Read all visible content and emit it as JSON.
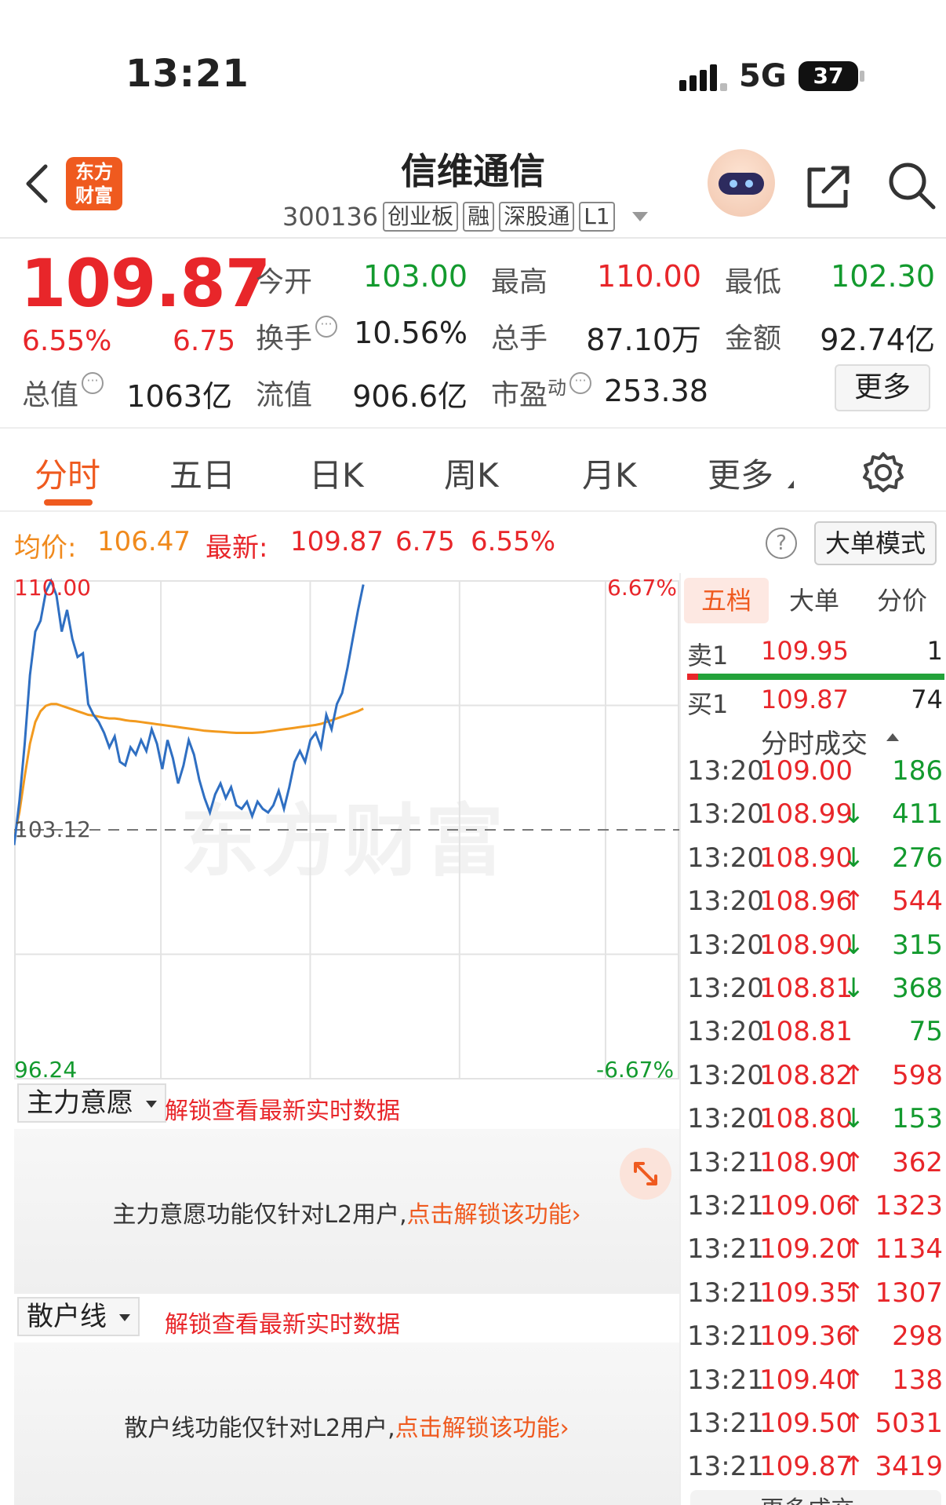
{
  "status_bar": {
    "time": "13:21",
    "network": "5G",
    "battery": "37"
  },
  "header": {
    "logo_text_1": "东方",
    "logo_text_2": "财富",
    "stock_name": "信维通信",
    "stock_code": "300136",
    "tags": [
      "创业板",
      "融",
      "深股通",
      "L1"
    ]
  },
  "quote": {
    "price": "109.87",
    "change_pct": "6.55%",
    "change": "6.75",
    "fields": {
      "open_label": "今开",
      "open": "103.00",
      "high_label": "最高",
      "high": "110.00",
      "low_label": "最低",
      "low": "102.30",
      "turnover_label": "换手",
      "turnover": "10.56%",
      "volume_label": "总手",
      "volume": "87.10万",
      "amount_label": "金额",
      "amount": "92.74亿",
      "mktcap_label": "总值",
      "mktcap": "1063亿",
      "float_label": "流值",
      "float": "906.6亿",
      "pe_label": "市盈",
      "pe_sup": "动",
      "pe": "253.38"
    },
    "more_label": "更多",
    "dots_glyph": "···"
  },
  "tabs": [
    "分时",
    "五日",
    "日K",
    "周K",
    "月K",
    "更多"
  ],
  "info_line": {
    "avg_label": "均价:",
    "avg": "106.47",
    "latest_label": "最新:",
    "latest": "109.87",
    "change": "6.75",
    "pct": "6.55%",
    "help": "?",
    "big_order_mode": "大单模式"
  },
  "chart_data": {
    "type": "line",
    "title": "",
    "y_top_label": "110.00",
    "y_mid_label": "103.12",
    "y_bottom_label": "96.24",
    "pct_top_label": "6.67%",
    "pct_bottom_label": "-6.67%",
    "ylim": [
      96.24,
      110.0
    ],
    "prev_close": 103.12,
    "watermark": "东方财富",
    "series": [
      {
        "name": "price",
        "values": [
          102.7,
          103.9,
          105.5,
          107.4,
          108.6,
          108.9,
          109.7,
          110.0,
          109.6,
          108.6,
          109.2,
          108.4,
          107.9,
          108.0,
          106.6,
          106.3,
          106.1,
          105.8,
          105.4,
          105.7,
          105.0,
          104.9,
          105.4,
          105.2,
          105.6,
          105.3,
          105.9,
          105.5,
          104.8,
          105.6,
          105.1,
          104.4,
          104.9,
          105.6,
          105.2,
          104.5,
          104.0,
          103.6,
          104.1,
          104.4,
          104.0,
          104.3,
          103.8,
          103.7,
          103.9,
          103.5,
          103.9,
          103.7,
          103.6,
          103.8,
          104.2,
          103.7,
          104.3,
          105.0,
          105.3,
          105.0,
          105.6,
          105.8,
          105.4,
          106.3,
          105.9,
          106.6,
          106.9,
          107.6,
          108.4,
          109.2,
          109.9
        ]
      },
      {
        "name": "avg",
        "values": [
          102.9,
          103.6,
          104.6,
          105.5,
          106.1,
          106.4,
          106.55,
          106.6,
          106.6,
          106.55,
          106.5,
          106.45,
          106.4,
          106.35,
          106.3,
          106.28,
          106.25,
          106.22,
          106.2,
          106.2,
          106.18,
          106.15,
          106.13,
          106.12,
          106.1,
          106.08,
          106.06,
          106.04,
          106.02,
          106.0,
          105.98,
          105.96,
          105.94,
          105.92,
          105.9,
          105.88,
          105.86,
          105.85,
          105.84,
          105.83,
          105.82,
          105.81,
          105.8,
          105.8,
          105.8,
          105.8,
          105.81,
          105.82,
          105.84,
          105.86,
          105.88,
          105.9,
          105.92,
          105.94,
          105.96,
          105.98,
          106.0,
          106.02,
          106.05,
          106.1,
          106.15,
          106.2,
          106.25,
          106.3,
          106.35,
          106.4,
          106.47
        ]
      }
    ]
  },
  "order_book": {
    "tabs": [
      "五档",
      "大单",
      "分价"
    ],
    "sell1_label": "卖1",
    "sell1_price": "109.95",
    "sell1_vol": "1",
    "buy1_label": "买1",
    "buy1_price": "109.87",
    "buy1_vol": "74",
    "ticks_title": "分时成交",
    "ticks": [
      {
        "time": "13:20",
        "price": "109.00",
        "dir": "",
        "vol": "186",
        "color": "#139a2e"
      },
      {
        "time": "13:20",
        "price": "108.99",
        "dir": "↓",
        "vol": "411",
        "color": "#139a2e"
      },
      {
        "time": "13:20",
        "price": "108.90",
        "dir": "↓",
        "vol": "276",
        "color": "#139a2e"
      },
      {
        "time": "13:20",
        "price": "108.96",
        "dir": "↑",
        "vol": "544",
        "color": "#e8262a"
      },
      {
        "time": "13:20",
        "price": "108.90",
        "dir": "↓",
        "vol": "315",
        "color": "#139a2e"
      },
      {
        "time": "13:20",
        "price": "108.81",
        "dir": "↓",
        "vol": "368",
        "color": "#139a2e"
      },
      {
        "time": "13:20",
        "price": "108.81",
        "dir": "",
        "vol": "75",
        "color": "#139a2e"
      },
      {
        "time": "13:20",
        "price": "108.82",
        "dir": "↑",
        "vol": "598",
        "color": "#e8262a"
      },
      {
        "time": "13:20",
        "price": "108.80",
        "dir": "↓",
        "vol": "153",
        "color": "#139a2e"
      },
      {
        "time": "13:21",
        "price": "108.90",
        "dir": "↑",
        "vol": "362",
        "color": "#e8262a"
      },
      {
        "time": "13:21",
        "price": "109.06",
        "dir": "↑",
        "vol": "1323",
        "color": "#e8262a"
      },
      {
        "time": "13:21",
        "price": "109.20",
        "dir": "↑",
        "vol": "1134",
        "color": "#e8262a"
      },
      {
        "time": "13:21",
        "price": "109.35",
        "dir": "↑",
        "vol": "1307",
        "color": "#e8262a"
      },
      {
        "time": "13:21",
        "price": "109.36",
        "dir": "↑",
        "vol": "298",
        "color": "#e8262a"
      },
      {
        "time": "13:21",
        "price": "109.40",
        "dir": "↑",
        "vol": "138",
        "color": "#e8262a"
      },
      {
        "time": "13:21",
        "price": "109.50",
        "dir": "↑",
        "vol": "5031",
        "color": "#e8262a"
      },
      {
        "time": "13:21",
        "price": "109.87",
        "dir": "↑",
        "vol": "3419",
        "color": "#e8262a"
      }
    ],
    "more_ticks": "更多成交 ›"
  },
  "indicators": [
    {
      "name": "主力意愿",
      "unlock": "解锁查看最新实时数据",
      "msg": "主力意愿功能仅针对L2用户,",
      "link": "点击解锁该功能›"
    },
    {
      "name": "散户线",
      "unlock": "解锁查看最新实时数据",
      "msg": "散户线功能仅针对L2用户,",
      "link": "点击解锁该功能›"
    }
  ],
  "colors": {
    "up": "#e8262a",
    "down": "#139a2e",
    "brand": "#ef5a1f",
    "price_line": "#2f6fc2",
    "avg_line": "#f29a1f"
  }
}
